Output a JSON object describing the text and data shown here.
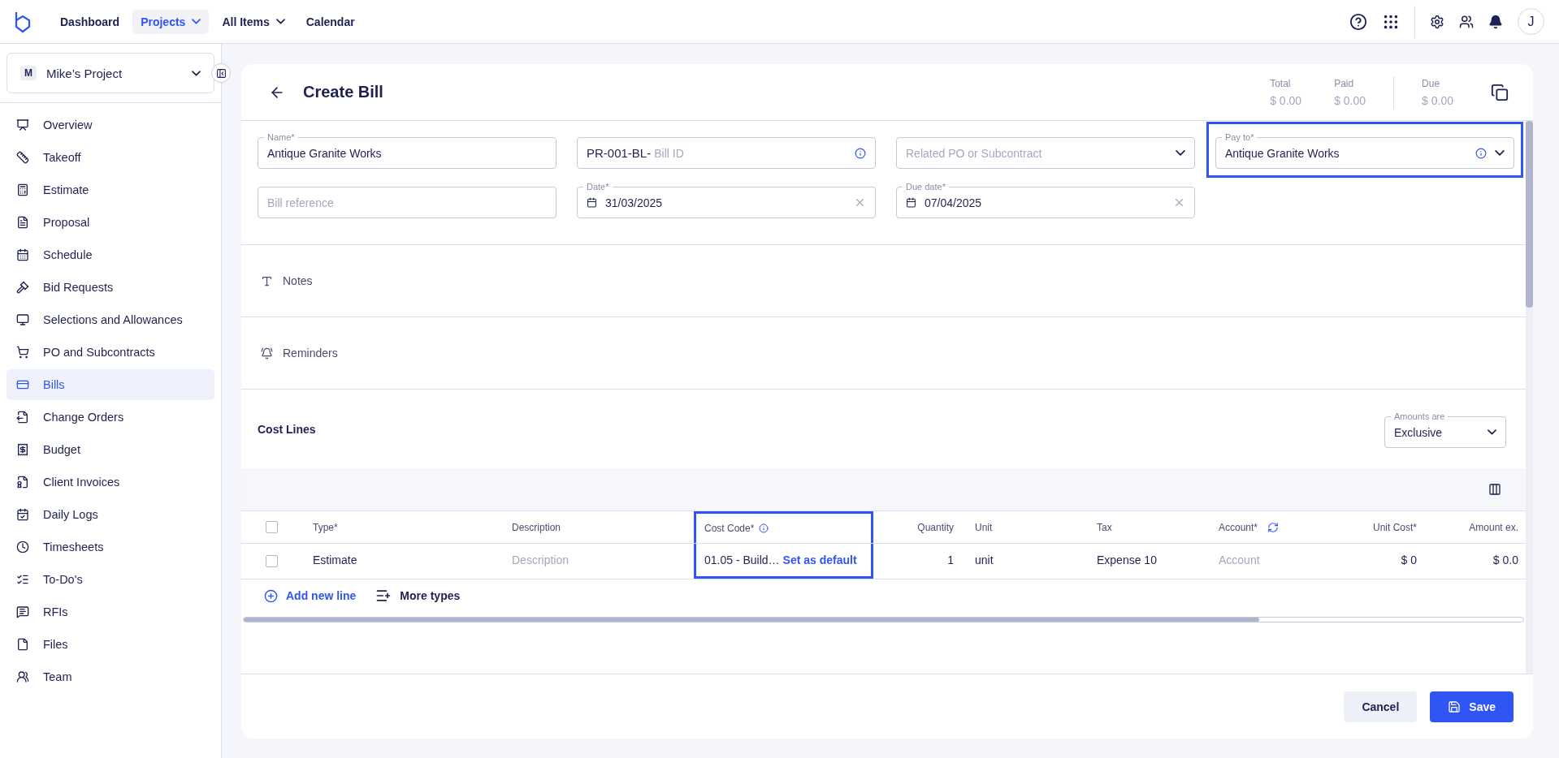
{
  "nav": {
    "items": [
      {
        "label": "Dashboard",
        "selected": false,
        "dropdown": false
      },
      {
        "label": "Projects",
        "selected": true,
        "dropdown": true
      },
      {
        "label": "All Items",
        "selected": false,
        "dropdown": true
      },
      {
        "label": "Calendar",
        "selected": false,
        "dropdown": false
      }
    ],
    "avatar": "J"
  },
  "project": {
    "initial": "M",
    "name": "Mike’s Project"
  },
  "sidebar": {
    "items": [
      {
        "kind": "overview",
        "label": "Overview",
        "selected": false
      },
      {
        "kind": "takeoff",
        "label": "Takeoff",
        "selected": false
      },
      {
        "kind": "estimate",
        "label": "Estimate",
        "selected": false
      },
      {
        "kind": "proposal",
        "label": "Proposal",
        "selected": false
      },
      {
        "kind": "schedule",
        "label": "Schedule",
        "selected": false
      },
      {
        "kind": "bid",
        "label": "Bid Requests",
        "selected": false
      },
      {
        "kind": "selections",
        "label": "Selections and Allowances",
        "selected": false
      },
      {
        "kind": "po",
        "label": "PO and Subcontracts",
        "selected": false
      },
      {
        "kind": "bills",
        "label": "Bills",
        "selected": true
      },
      {
        "kind": "change",
        "label": "Change Orders",
        "selected": false
      },
      {
        "kind": "budget",
        "label": "Budget",
        "selected": false
      },
      {
        "kind": "invoices",
        "label": "Client Invoices",
        "selected": false
      },
      {
        "kind": "logs",
        "label": "Daily Logs",
        "selected": false
      },
      {
        "kind": "timesheets",
        "label": "Timesheets",
        "selected": false
      },
      {
        "kind": "todo",
        "label": "To-Do's",
        "selected": false
      },
      {
        "kind": "rfi",
        "label": "RFIs",
        "selected": false
      },
      {
        "kind": "files",
        "label": "Files",
        "selected": false
      },
      {
        "kind": "team",
        "label": "Team",
        "selected": false
      }
    ]
  },
  "bill": {
    "title": "Create Bill",
    "totals": [
      {
        "label": "Total",
        "value": "$ 0.00"
      },
      {
        "label": "Paid",
        "value": "$ 0.00"
      },
      {
        "label": "Due",
        "value": "$ 0.00"
      }
    ],
    "fields": [
      {
        "kind": "text",
        "label": "Name*",
        "value": "Antique Granite Works",
        "highlighted": false
      },
      {
        "kind": "id",
        "prefix": "PR-001-BL-",
        "placeholder": "Bill ID",
        "highlighted": false
      },
      {
        "kind": "select",
        "placeholder": "Related PO or Subcontract",
        "highlighted": false
      },
      {
        "kind": "select",
        "label": "Pay to*",
        "value": "Antique Granite Works",
        "info": true,
        "highlighted": true
      },
      {
        "kind": "text",
        "placeholder": "Bill reference",
        "highlighted": false
      },
      {
        "kind": "date",
        "label": "Date*",
        "value": "31/03/2025",
        "highlighted": false
      },
      {
        "kind": "date",
        "label": "Due date*",
        "value": "07/04/2025",
        "highlighted": false
      }
    ],
    "sections": [
      {
        "kind": "notes",
        "label": "Notes"
      },
      {
        "kind": "reminders",
        "label": "Reminders"
      }
    ],
    "cost_lines": {
      "title": "Cost Lines",
      "amounts": {
        "label": "Amounts are",
        "value": "Exclusive"
      },
      "columns": [
        {
          "label": "Type*",
          "kind": "text",
          "highlighted": false
        },
        {
          "label": "Description",
          "kind": "text",
          "highlighted": false
        },
        {
          "label": "Cost Code*",
          "kind": "text",
          "info": true,
          "highlighted": true
        },
        {
          "label": "Quantity",
          "kind": "number",
          "highlighted": false
        },
        {
          "label": "Unit",
          "kind": "text",
          "highlighted": false
        },
        {
          "label": "Tax",
          "kind": "text",
          "highlighted": false
        },
        {
          "label": "Account*",
          "kind": "text",
          "refresh": true,
          "highlighted": false
        },
        {
          "label": "Unit Cost*",
          "kind": "number",
          "highlighted": false
        },
        {
          "label": "Amount ex.",
          "kind": "number",
          "highlighted": false
        }
      ],
      "header_checked": false,
      "rows": [
        {
          "checked": false,
          "cells": [
            {
              "value": "Estimate"
            },
            {
              "placeholder": "Description"
            },
            {
              "value": "01.05 - Build…",
              "link": "Set as default"
            },
            {
              "value": "1"
            },
            {
              "value": "unit"
            },
            {
              "value": "Expense 10"
            },
            {
              "placeholder": "Account"
            },
            {
              "value": "$ 0"
            },
            {
              "value": "$ 0.0"
            }
          ]
        }
      ],
      "actions": [
        {
          "kind": "add",
          "label": "Add new line"
        },
        {
          "kind": "types",
          "label": "More types"
        }
      ]
    },
    "buttons": [
      {
        "kind": "secondary",
        "label": "Cancel"
      },
      {
        "kind": "primary",
        "label": "Save"
      }
    ]
  }
}
